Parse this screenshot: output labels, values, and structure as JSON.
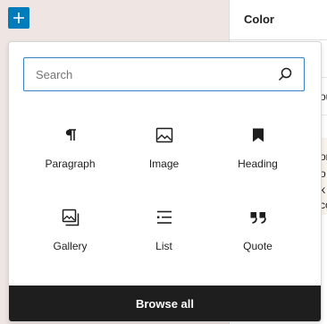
{
  "toolbar": {
    "add_icon": "plus-icon",
    "accent": "#007cba"
  },
  "sidebar": {
    "title": "Color",
    "peek": [
      "ou",
      "or",
      "o",
      "k",
      "co"
    ]
  },
  "inserter": {
    "search": {
      "placeholder": "Search",
      "value": "",
      "icon": "search-icon"
    },
    "blocks": [
      {
        "label": "Paragraph",
        "icon": "paragraph-icon"
      },
      {
        "label": "Image",
        "icon": "image-icon"
      },
      {
        "label": "Heading",
        "icon": "bookmark-icon"
      },
      {
        "label": "Gallery",
        "icon": "gallery-icon"
      },
      {
        "label": "List",
        "icon": "list-icon"
      },
      {
        "label": "Quote",
        "icon": "quote-icon"
      }
    ],
    "browse_all": "Browse all"
  }
}
